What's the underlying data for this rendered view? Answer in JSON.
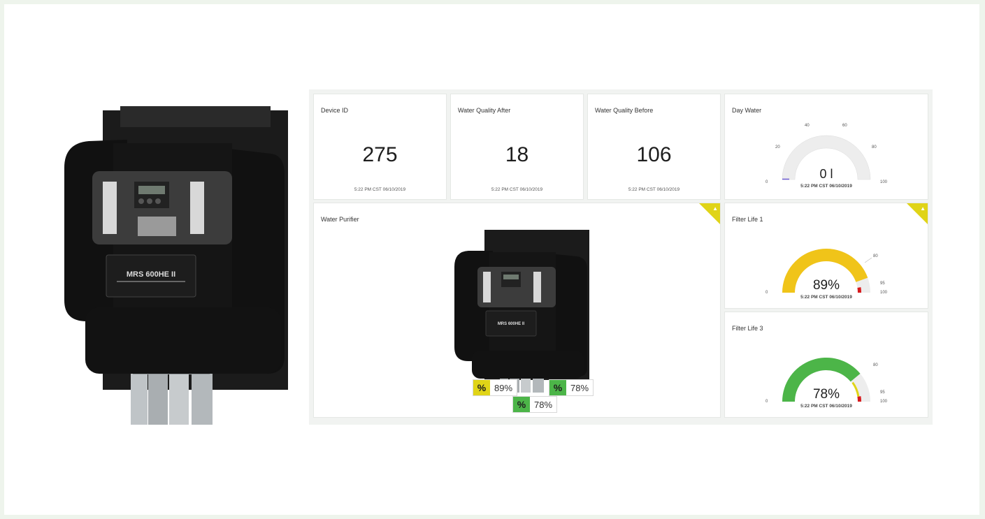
{
  "colors": {
    "yellow": "#e0d417",
    "gauge_yellow": "#f0c419",
    "green": "#4cb548",
    "red": "#d7191c",
    "track": "#ededed",
    "purple": "#6b5bd1"
  },
  "photo": {
    "label": "MRS 600HE II"
  },
  "tiles": {
    "device_id": {
      "title": "Device ID",
      "value": "275",
      "timestamp": "5:22 PM CST 06/10/2019"
    },
    "quality_after": {
      "title": "Water Quality After",
      "value": "18",
      "timestamp": "5:22 PM CST 06/10/2019"
    },
    "quality_before": {
      "title": "Water Quality Before",
      "value": "106",
      "timestamp": "5:22 PM CST 06/10/2019"
    }
  },
  "day_water": {
    "title": "Day Water",
    "value": "0 l",
    "timestamp": "5:22 PM CST 06/10/2019",
    "level": 0,
    "ticks": [
      "0",
      "20",
      "40",
      "60",
      "80",
      "100"
    ]
  },
  "purifier": {
    "title": "Water Purifier",
    "alert_icon": "warning-icon",
    "unit_label": "MRS 600HE II",
    "tags": [
      {
        "icon": "percent-icon",
        "value": "89%",
        "color": "#e0d417"
      },
      {
        "icon": "percent-icon",
        "value": "78%",
        "color": "#4cb548"
      },
      {
        "icon": "percent-icon",
        "value": "78%",
        "color": "#4cb548"
      }
    ]
  },
  "filter1": {
    "title": "Filter Life 1",
    "value": "89%",
    "timestamp": "5:22 PM CST 06/10/2019",
    "level": 89,
    "ticks": [
      "0",
      "80",
      "95",
      "100"
    ],
    "alert_icon": "warning-icon"
  },
  "filter3": {
    "title": "Filter Life 3",
    "value": "78%",
    "timestamp": "5:22 PM CST 06/10/2019",
    "level": 78,
    "ticks": [
      "0",
      "80",
      "95",
      "100"
    ]
  }
}
